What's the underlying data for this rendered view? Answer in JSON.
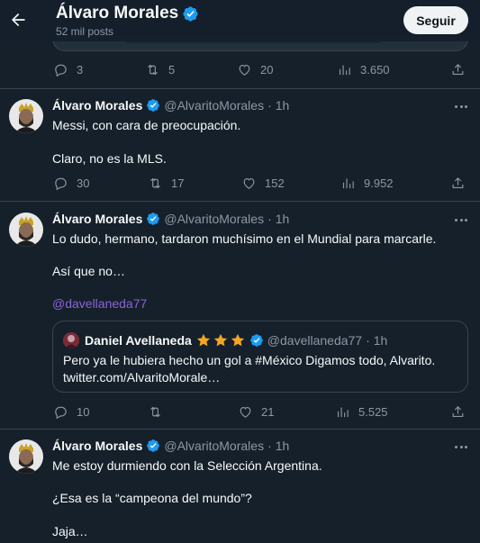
{
  "header": {
    "name": "Álvaro Morales",
    "post_count": "52 mil posts",
    "follow_label": "Seguir"
  },
  "top_actions": {
    "replies": "3",
    "reposts": "5",
    "likes": "20",
    "views": "3.650"
  },
  "tweets": [
    {
      "name": "Álvaro Morales",
      "handle": "@AlvaritoMorales",
      "separator": "·",
      "time": "1h",
      "line1": "Messi, con cara de preocupación.",
      "line2": "Claro, no es la MLS.",
      "replies": "30",
      "reposts": "17",
      "likes": "152",
      "views": "9.952"
    },
    {
      "name": "Álvaro Morales",
      "handle": "@AlvaritoMorales",
      "separator": "·",
      "time": "1h",
      "line1": "Lo dudo, hermano, tardaron muchísimo en el Mundial para marcarle.",
      "line2": "Así que no…",
      "mention": "@davellaneda77",
      "quote": {
        "name": "Daniel Avellaneda",
        "handle": "@davellaneda77",
        "separator": "·",
        "time": "1h",
        "line1": "Pero ya le hubiera hecho un gol a #México Digamos todo, Alvarito.",
        "line2": "twitter.com/AlvaritoMorale…"
      },
      "replies": "10",
      "reposts": "",
      "likes": "21",
      "views": "5.525"
    },
    {
      "name": "Álvaro Morales",
      "handle": "@AlvaritoMorales",
      "separator": "·",
      "time": "1h",
      "line1": "Me estoy durmiendo con la Selección Argentina.",
      "line2": "¿Esa es la “campeona del mundo”?",
      "line3": "Jaja…"
    }
  ],
  "colors": {
    "background": "#15202b",
    "text": "#f7f9f9",
    "secondary": "#8b98a5",
    "verified": "#1d9bf0",
    "border": "#38444d",
    "mention": "#8b63d9",
    "star": "#f4a623"
  },
  "icons": {
    "back": "arrow-left-icon",
    "verified": "verified-badge-icon",
    "reply": "reply-icon",
    "repost": "repost-icon",
    "like": "heart-icon",
    "views": "views-icon",
    "share": "share-icon",
    "more": "more-icon",
    "star": "star-icon"
  }
}
